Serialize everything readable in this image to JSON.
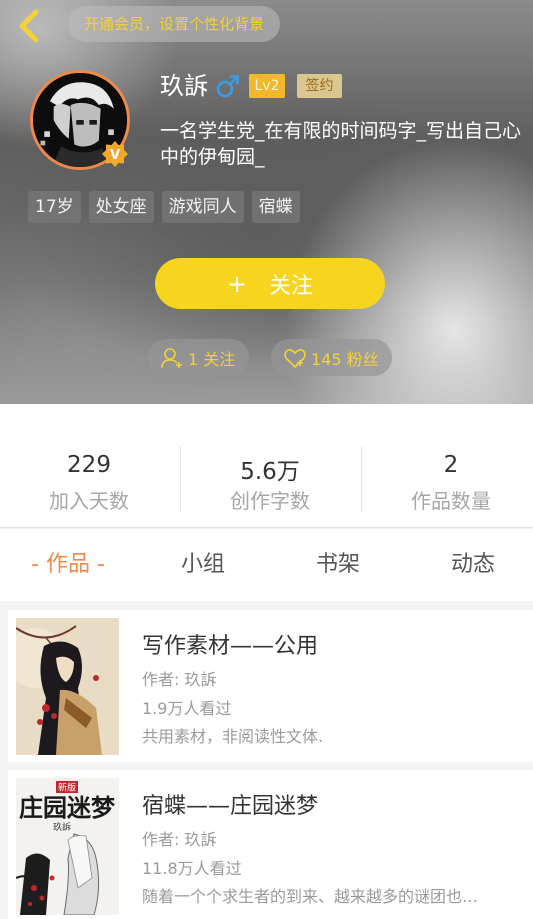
{
  "header": {
    "vip_banner": "开通会员，设置个性化背景",
    "username": "玖訴",
    "gender_symbol": "♂",
    "level_badge": "Lv2",
    "signed_badge": "签约",
    "bio": "一名学生党_在有限的时间码字_写出自己心中的伊甸园_",
    "tags": [
      "17岁",
      "处女座",
      "游戏同人",
      "宿蝶"
    ],
    "follow_plus": "+",
    "follow_label": "关注",
    "following_text": "1 关注",
    "fans_text": "145 粉丝",
    "colors": {
      "accent_yellow": "#f7d51f",
      "gender_blue": "#3a9ce8",
      "avatar_ring": "#ef8a4a"
    }
  },
  "stats": [
    {
      "value": "229",
      "label": "加入天数"
    },
    {
      "value": "5.6万",
      "label": "创作字数"
    },
    {
      "value": "2",
      "label": "作品数量"
    }
  ],
  "tabs": [
    {
      "label": "- 作品 -",
      "active": true
    },
    {
      "label": "小组",
      "active": false
    },
    {
      "label": "书架",
      "active": false
    },
    {
      "label": "动态",
      "active": false
    }
  ],
  "works": [
    {
      "title": "写作素材——公用",
      "author": "作者: 玖訴",
      "views": "1.9万人看过",
      "desc": "共用素材，非阅读性文体."
    },
    {
      "title": "宿蝶——庄园迷梦",
      "author": "作者: 玖訴",
      "views": "11.8万人看过",
      "desc": "随着一个个求生者的到来、越来越多的谜团也…",
      "cover_title": "庄园迷梦",
      "cover_tag": "新版",
      "cover_author": "玖訴"
    }
  ],
  "icons": {
    "back": "chevron-left-icon",
    "gender": "male-icon",
    "verified": "v-badge-icon",
    "following": "person-add-icon",
    "fans": "heart-icon"
  }
}
